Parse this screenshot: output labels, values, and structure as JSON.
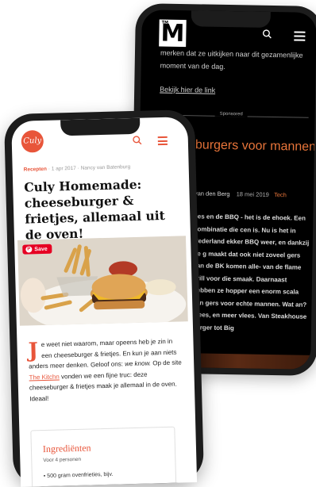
{
  "back": {
    "logo": "M",
    "logo_tm": "TM",
    "intro_text": "merken dat ze uitkijken naar dit gezamenlijke moment van de dag.",
    "link": "Bekijk hier de link",
    "sponsored": "Sponsored",
    "title": "burgers voor mannen",
    "author": "van den Berg",
    "date": "18 mei 2019",
    "tag": "Tech",
    "body": "ees en de BBQ - het is de ehoek. Een combinatie die cen is. Nu is het in Nederland ekker BBQ weer, en dankzij de g maakt dat ook niet zoveel gers van de BK komen alle- van de flame grill voor die smaak. Daarnaast hebben ze hopper een enorm scala aan gers voor echte mannen. Wat an? Vlees, en meer vlees. Van Steakhouse burger tot Big"
  },
  "front": {
    "logo": "Culy",
    "category": "Recepten",
    "date": "1 apr 2017",
    "author": "Nancy van Batenburg",
    "title": "Culy Homemade: cheeseburger & frietjes, allemaal uit de oven!",
    "save_label": "Save",
    "dropcap": "J",
    "body_a": "e weet niet waarom, maar opeens heb je zin in een cheeseburger & frietjes. En kun je aan niets anders meer denken. Geloof ons:",
    "body_em": "we know.",
    "body_b": "Op de site",
    "body_link": "The Kitchn",
    "body_c": "vonden we een fijne truc: deze cheeseburger & frietjes maak je allemaal in de oven. Ideaal!",
    "ingredients_title": "Ingrediënten",
    "ingredients_sub": "Voor 4 personen",
    "ingredient_1": "500 gram ovenfrieties, bijv."
  }
}
